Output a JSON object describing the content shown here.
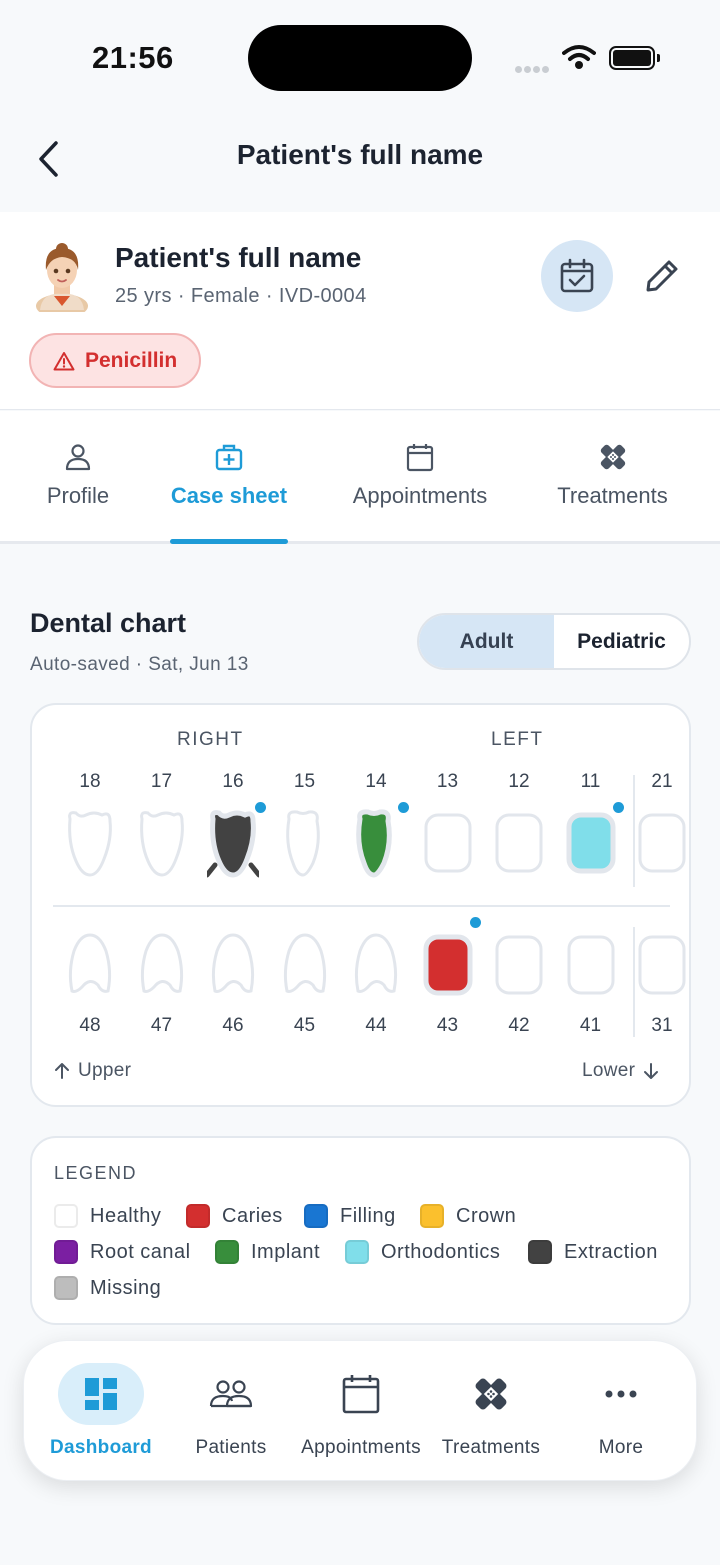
{
  "status_bar": {
    "time": "21:56"
  },
  "header": {
    "title": "Patient's full name"
  },
  "patient": {
    "name": "Patient's full name",
    "meta": "25 yrs · Female · IVD-0004",
    "allergy": "Penicillin"
  },
  "tabs": [
    {
      "label": "Profile",
      "icon": "person-icon"
    },
    {
      "label": "Case sheet",
      "icon": "medical-case-icon",
      "active": true
    },
    {
      "label": "Appointments",
      "icon": "calendar-icon"
    },
    {
      "label": "Treatments",
      "icon": "bandage-icon"
    }
  ],
  "dental_chart": {
    "title": "Dental chart",
    "subtitle": "Auto-saved · Sat, Jun 13",
    "toggle": {
      "adult": "Adult",
      "pediatric": "Pediatric",
      "selected": "Adult"
    },
    "right_label": "RIGHT",
    "left_label": "LEFT",
    "upper_label": "Upper",
    "lower_label": "Lower",
    "upper_teeth": [
      {
        "num": "18",
        "status": "healthy"
      },
      {
        "num": "17",
        "status": "healthy"
      },
      {
        "num": "16",
        "status": "extraction",
        "marked": true
      },
      {
        "num": "15",
        "status": "healthy"
      },
      {
        "num": "14",
        "status": "implant",
        "marked": true
      },
      {
        "num": "13",
        "status": "healthy"
      },
      {
        "num": "12",
        "status": "healthy"
      },
      {
        "num": "11",
        "status": "orthodontics",
        "marked": true
      },
      {
        "num": "21",
        "status": "healthy"
      }
    ],
    "lower_teeth": [
      {
        "num": "48",
        "status": "healthy"
      },
      {
        "num": "47",
        "status": "healthy"
      },
      {
        "num": "46",
        "status": "healthy"
      },
      {
        "num": "45",
        "status": "healthy"
      },
      {
        "num": "44",
        "status": "healthy"
      },
      {
        "num": "43",
        "status": "caries",
        "marked": true
      },
      {
        "num": "42",
        "status": "healthy"
      },
      {
        "num": "41",
        "status": "healthy"
      },
      {
        "num": "31",
        "status": "healthy"
      }
    ]
  },
  "legend": {
    "title": "LEGEND",
    "items": [
      {
        "label": "Healthy",
        "color": "#ffffff"
      },
      {
        "label": "Caries",
        "color": "#d32f2f"
      },
      {
        "label": "Filling",
        "color": "#1976d2"
      },
      {
        "label": "Crown",
        "color": "#fbc02d"
      },
      {
        "label": "Root canal",
        "color": "#7b1fa2"
      },
      {
        "label": "Implant",
        "color": "#388e3c"
      },
      {
        "label": "Orthodontics",
        "color": "#80deea"
      },
      {
        "label": "Extraction",
        "color": "#424242"
      },
      {
        "label": "Missing",
        "color": "#bdbdbd"
      }
    ]
  },
  "bottom_nav": [
    {
      "label": "Dashboard",
      "icon": "dashboard-icon",
      "active": true
    },
    {
      "label": "Patients",
      "icon": "people-icon"
    },
    {
      "label": "Appointments",
      "icon": "calendar-icon"
    },
    {
      "label": "Treatments",
      "icon": "bandage-icon"
    },
    {
      "label": "More",
      "icon": "more-icon"
    }
  ],
  "colors": {
    "accent": "#1e9bd7",
    "danger": "#d32f2f"
  }
}
